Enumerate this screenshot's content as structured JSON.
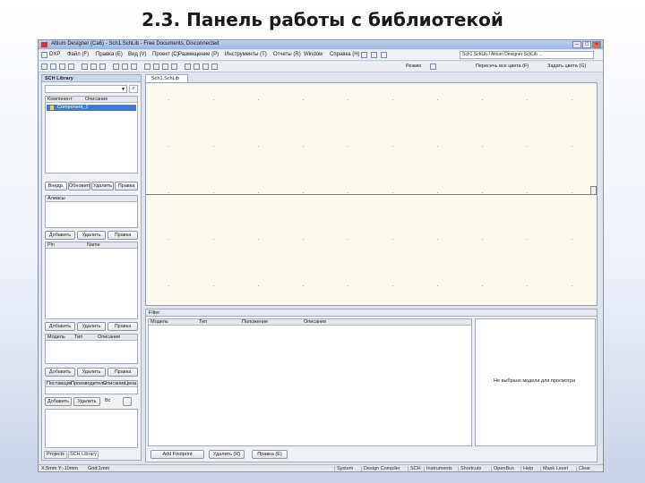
{
  "slide": {
    "title": "2.3. Панель работы с библиотекой"
  },
  "window": {
    "title": "Altium Designer (Ca6) - Sch1.SchLib - Free Documents, Disconnected",
    "doc_path": "Sch1.SchLib / Altium Designer SchLib ...",
    "right_fields": [
      "Пересечь все цвета (F)",
      "Задать цвета (G)"
    ]
  },
  "menu": [
    "DXP",
    "Файл (F)",
    "Правка (E)",
    "Вид (V)",
    "Проект (C)",
    "Размещение (P)",
    "Инструменты (T)",
    "Отчеты (R)",
    "Window",
    "Справка (H)"
  ],
  "toolbar": {
    "mode": "Режим"
  },
  "lib_panel": {
    "title": "SCH Library",
    "col_component": "Компонент",
    "col_description": "Описание",
    "selected_component": "Component_1",
    "comp_buttons": [
      "Внедр.",
      "Обновить",
      "Удалить",
      "Правка"
    ],
    "aliases_label": "Алиасы",
    "alias_buttons": [
      "Добавить",
      "Удалить",
      "Правка"
    ],
    "pins_col1": "Pin",
    "pins_col2": "Name",
    "pin_buttons": [
      "Добавить",
      "Удалить",
      "Правка"
    ],
    "models_col1": "Модель",
    "models_col2": "Тип",
    "models_col3": "Описание",
    "model_buttons": [
      "Добавить",
      "Удалить",
      "Правка"
    ],
    "supplier_cols": [
      "Поставщик",
      "Производитель",
      "Описание",
      "Цена"
    ],
    "supplier_buttons": [
      "Добавить",
      "Удалить"
    ],
    "supplier_extra": "Вс",
    "tabs": [
      "Projects",
      "SCH Library"
    ]
  },
  "document": {
    "tab": "Sch1.SchLib"
  },
  "filter_panel": {
    "title": "Filter",
    "columns": [
      "Модель",
      "Тип",
      "Положение",
      "Описание"
    ],
    "buttons": [
      "Add Footprint",
      "Удалить (R)",
      "Правка (E)"
    ],
    "preview_text": "Не выбрано модели для просмотра"
  },
  "status": {
    "left": "X:5mm Y:-10mm",
    "grid": "Grid:1mm",
    "right_items": [
      "System",
      "Design Compiler",
      "SCH",
      "Instruments",
      "Shortcuts",
      "OpenBus",
      "Help",
      "Mask Level",
      "Clear"
    ]
  }
}
